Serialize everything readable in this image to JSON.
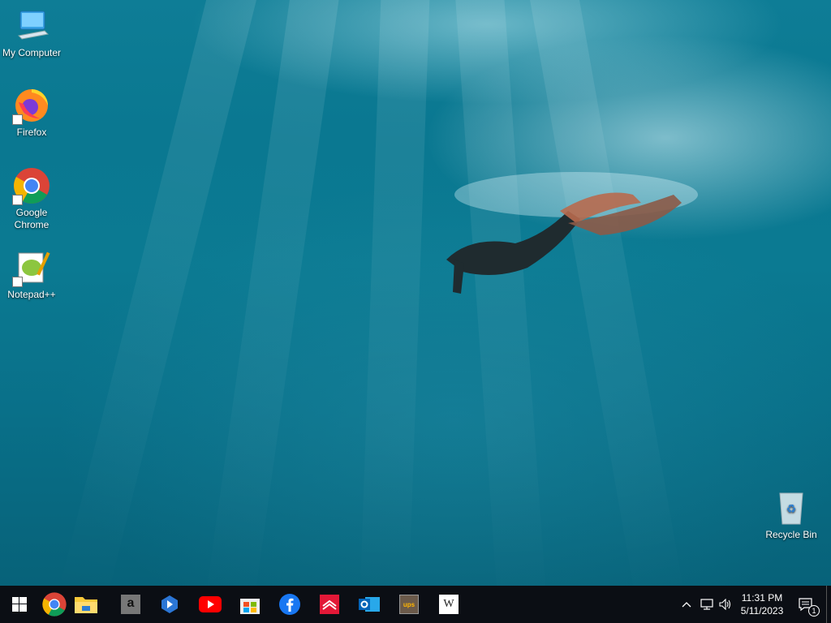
{
  "desktop": {
    "icons": [
      {
        "label": "My Computer"
      },
      {
        "label": "Firefox"
      },
      {
        "label": "Google Chrome"
      },
      {
        "label": "Notepad++"
      },
      {
        "label": "Recycle Bin"
      }
    ]
  },
  "taskbar": {
    "apps": [
      "start-icon",
      "chrome-icon",
      "file-explorer-icon",
      "amazon-icon",
      "bing-icon",
      "youtube-icon",
      "microsoft-store-icon",
      "facebook-icon",
      "bank-of-america-icon",
      "outlook-icon",
      "ups-icon",
      "wikipedia-icon"
    ],
    "amazon_glyph": "a",
    "wikipedia_glyph": "W",
    "ups_glyph": "ups"
  },
  "tray": {
    "time": "11:31 PM",
    "date": "5/11/2023",
    "notification_count": "1"
  },
  "colors": {
    "taskbar": "#0b0e14",
    "water": "#0a7891"
  }
}
